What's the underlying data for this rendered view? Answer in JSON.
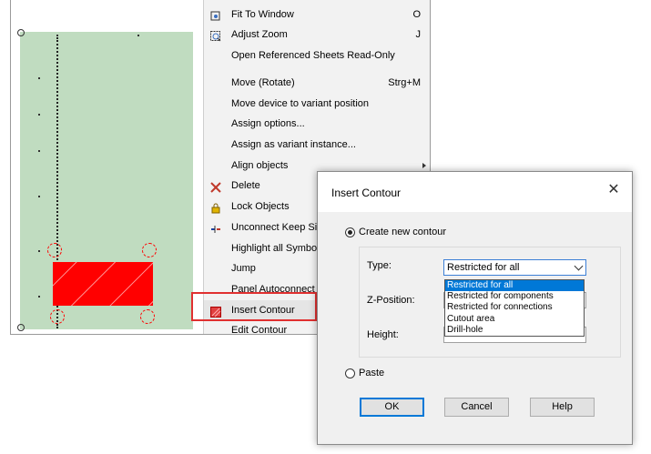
{
  "context_menu": {
    "items": [
      {
        "label": "Fit To Window",
        "shortcut": "O",
        "icon": "fit-window-icon"
      },
      {
        "label": "Adjust Zoom",
        "shortcut": "J",
        "icon": "zoom-icon"
      },
      {
        "label": "Open Referenced Sheets Read-Only",
        "shortcut": ""
      },
      {
        "label": "Move (Rotate)",
        "shortcut": "Strg+M"
      },
      {
        "label": "Move device to variant position",
        "shortcut": ""
      },
      {
        "label": "Assign options...",
        "shortcut": ""
      },
      {
        "label": "Assign as variant instance...",
        "shortcut": ""
      },
      {
        "label": "Align objects",
        "shortcut": "",
        "submenu": true
      },
      {
        "label": "Delete",
        "shortcut": "",
        "icon": "delete-x-icon"
      },
      {
        "label": "Lock Objects",
        "shortcut": "",
        "icon": "lock-icon"
      },
      {
        "label": "Unconnect Keep Signal",
        "shortcut": "",
        "icon": "unconnect-icon"
      },
      {
        "label": "Highlight all Symbols",
        "shortcut": ""
      },
      {
        "label": "Jump",
        "shortcut": ""
      },
      {
        "label": "Panel Autoconnect",
        "shortcut": ""
      },
      {
        "label": "Insert Contour",
        "shortcut": "",
        "icon": "contour-icon",
        "highlighted": true
      },
      {
        "label": "Edit Contour",
        "shortcut": ""
      }
    ]
  },
  "dialog": {
    "title": "Insert Contour",
    "close_glyph": "✕",
    "radio_new": "Create new contour",
    "radio_paste": "Paste",
    "type_label": "Type:",
    "type_value": "Restricted for all",
    "zpos_label": "Z-Position:",
    "height_label": "Height:",
    "type_options": [
      "Restricted for all",
      "Restricted for components",
      "Restricted for connections",
      "Cutout area",
      "Drill-hole"
    ],
    "selected_option_index": 0,
    "ok": "OK",
    "cancel": "Cancel",
    "help": "Help"
  },
  "colors": {
    "sheet_bg": "#c0dcc0",
    "contour_red": "#ff0000",
    "highlight_border": "#e03030",
    "selection_blue": "#0078d7"
  }
}
